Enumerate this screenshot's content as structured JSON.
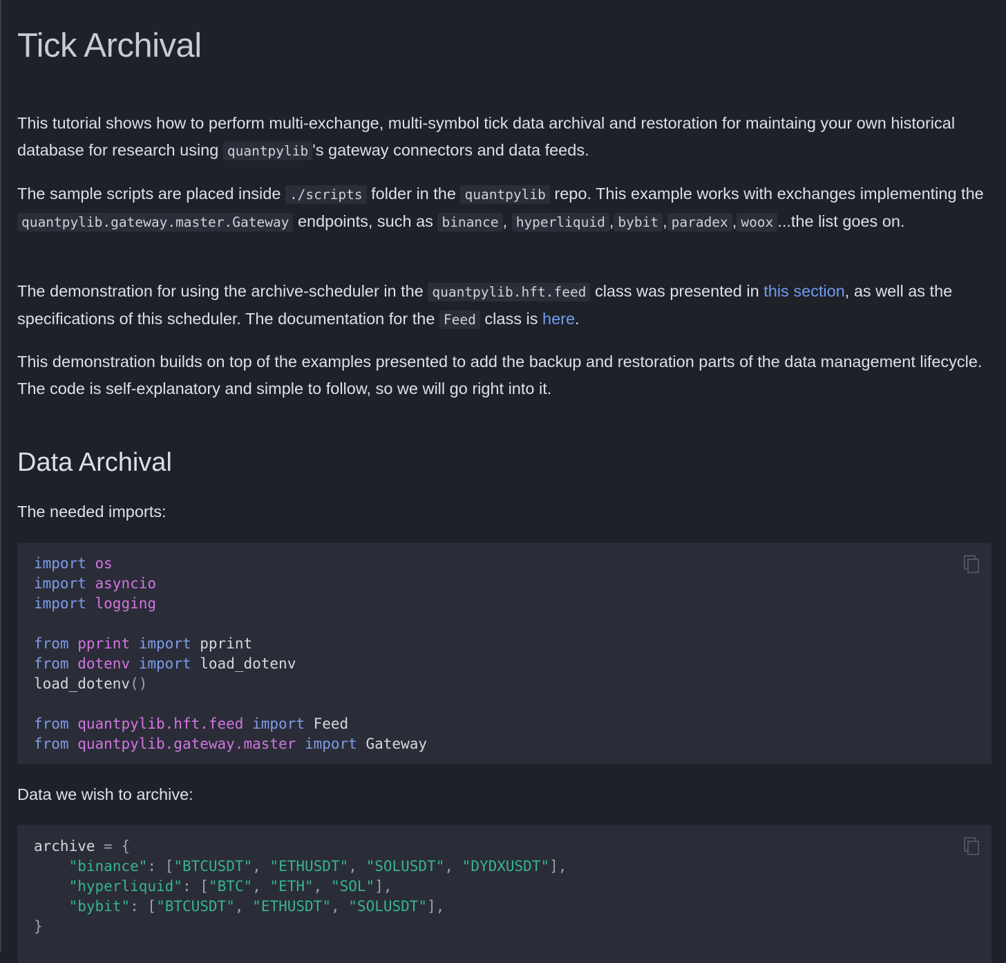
{
  "title": "Tick Archival",
  "intro": {
    "p1_a": "This tutorial shows how to perform multi-exchange, multi-symbol tick data archival and restoration for maintaing your own historical database for research using ",
    "p1_code": "quantpylib",
    "p1_b": "'s gateway connectors and data feeds.",
    "p2_a": "The sample scripts are placed inside ",
    "p2_code1": "./scripts",
    "p2_b": " folder in the ",
    "p2_code2": "quantpylib",
    "p2_c": " repo. This example works with exchanges implementing the ",
    "p2_code3": "quantpylib.gateway.master.Gateway",
    "p2_d": " endpoints, such as ",
    "p2_ex1": "binance",
    "p2_ex2": "hyperliquid",
    "p2_ex3": "bybit",
    "p2_ex4": "paradex",
    "p2_ex5": "woox",
    "p2_e": "...the list goes on.",
    "p3_a": "The demonstration for using the archive-scheduler in the ",
    "p3_code1": "quantpylib.hft.feed",
    "p3_b": " class was presented in ",
    "p3_link1": "this section",
    "p3_c": ", as well as the specifications of this scheduler. The documentation for the ",
    "p3_code2": "Feed",
    "p3_d": " class is ",
    "p3_link2": "here",
    "p3_e": ".",
    "p4": "This demonstration builds on top of the examples presented to add the backup and restoration parts of the data management lifecycle. The code is self-explanatory and simple to follow, so we will go right into it."
  },
  "section": {
    "heading": "Data Archival",
    "imports_label": "The needed imports:",
    "archive_label": "Data we wish to archive:"
  },
  "code_imports": {
    "kw_import": "import",
    "kw_from": "from",
    "m_os": "os",
    "m_asyncio": "asyncio",
    "m_logging": "logging",
    "m_pprint": "pprint",
    "n_pprint": "pprint",
    "m_dotenv": "dotenv",
    "n_load_dotenv": "load_dotenv",
    "call_load_dotenv": "load_dotenv",
    "m_feed": "quantpylib.hft.feed",
    "n_feed": "Feed",
    "m_gateway": "quantpylib.gateway.master",
    "n_gateway": "Gateway"
  },
  "code_archive": {
    "var": "archive",
    "k_binance": "\"binance\"",
    "k_hyperliquid": "\"hyperliquid\"",
    "k_bybit": "\"bybit\"",
    "binance": [
      "\"BTCUSDT\"",
      "\"ETHUSDT\"",
      "\"SOLUSDT\"",
      "\"DYDXUSDT\""
    ],
    "hyperliquid": [
      "\"BTC\"",
      "\"ETH\"",
      "\"SOL\""
    ],
    "bybit": [
      "\"BTCUSDT\"",
      "\"ETHUSDT\"",
      "\"SOLUSDT\""
    ]
  },
  "icons": {
    "copy": "copy-icon"
  }
}
